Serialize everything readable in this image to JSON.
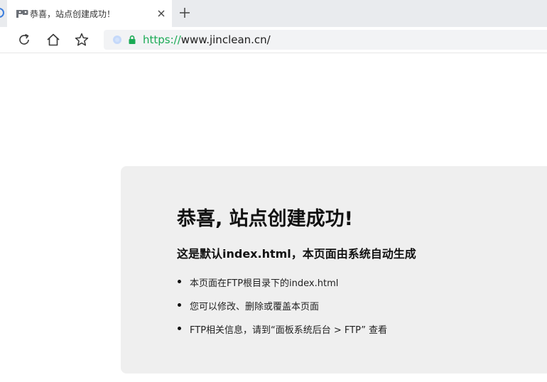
{
  "tab": {
    "title": "恭喜，站点创建成功！"
  },
  "address_bar": {
    "scheme": "https://",
    "host_path": "www.jinclean.cn/"
  },
  "icons": {
    "tab_favicon": "site-favicon-icon",
    "close": "close-icon",
    "new_tab": "plus-icon",
    "reload": "reload-icon",
    "home": "home-icon",
    "bookmark": "star-icon",
    "secure": "lock-icon",
    "site_info": "site-info-icon"
  },
  "colors": {
    "secure_green": "#1aaa55",
    "tabstrip_bg": "#e9ebee",
    "content_bg": "#efefef"
  },
  "page": {
    "headline": "恭喜, 站点创建成功!",
    "subheading": "这是默认index.html，本页面由系统自动生成",
    "items": [
      "本页面在FTP根目录下的index.html",
      "您可以修改、删除或覆盖本页面",
      "FTP相关信息，请到“面板系统后台 > FTP” 查看"
    ]
  }
}
